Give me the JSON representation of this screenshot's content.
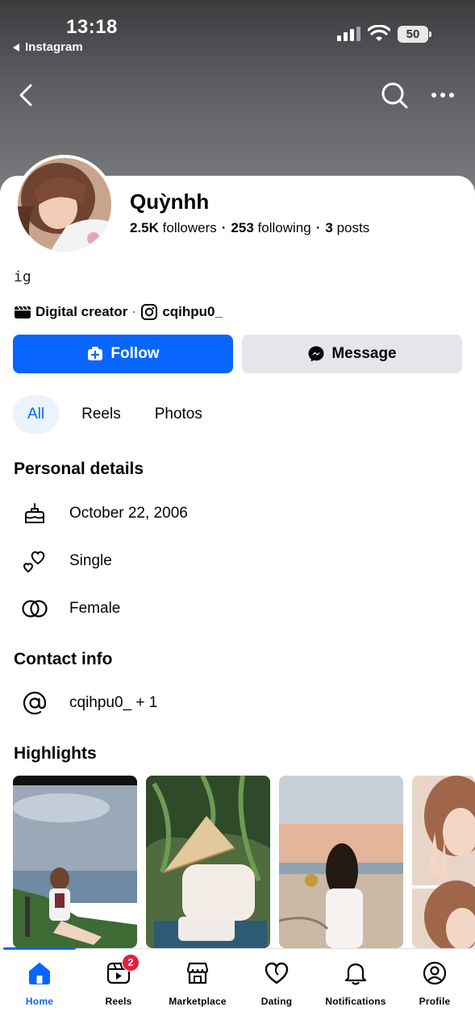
{
  "status_bar": {
    "time": "13:18",
    "back_app": "Instagram",
    "battery": "50"
  },
  "profile": {
    "name": "Quỳnhh",
    "followers_count": "2.5K",
    "followers_label": "followers",
    "following_count": "253",
    "following_label": "following",
    "posts_count": "3",
    "posts_label": "posts",
    "bio": "ig",
    "category": "Digital creator",
    "instagram_handle": "cqihpu0_"
  },
  "actions": {
    "follow_label": "Follow",
    "message_label": "Message"
  },
  "tabs": [
    {
      "label": "All",
      "active": true
    },
    {
      "label": "Reels",
      "active": false
    },
    {
      "label": "Photos",
      "active": false
    }
  ],
  "personal_details": {
    "title": "Personal details",
    "items": [
      {
        "icon": "birthday-cake-icon",
        "text": "October 22, 2006"
      },
      {
        "icon": "hearts-icon",
        "text": "Single"
      },
      {
        "icon": "gender-icon",
        "text": "Female"
      }
    ]
  },
  "contact_info": {
    "title": "Contact info",
    "items": [
      {
        "icon": "at-sign-icon",
        "text": "cqihpu0_ + 1"
      }
    ]
  },
  "highlights": {
    "title": "Highlights"
  },
  "bottom_nav": {
    "items": [
      {
        "label": "Home",
        "icon": "home-icon",
        "active": true
      },
      {
        "label": "Reels",
        "icon": "reels-icon",
        "badge": "2"
      },
      {
        "label": "Marketplace",
        "icon": "marketplace-icon"
      },
      {
        "label": "Dating",
        "icon": "dating-heart-icon"
      },
      {
        "label": "Notifications",
        "icon": "bell-icon"
      },
      {
        "label": "Profile",
        "icon": "profile-icon"
      }
    ]
  },
  "colors": {
    "accent": "#0866ff",
    "badge": "#e41e3f",
    "tab_active_bg": "#ebf3ff",
    "secondary_button": "#e4e6eb"
  }
}
